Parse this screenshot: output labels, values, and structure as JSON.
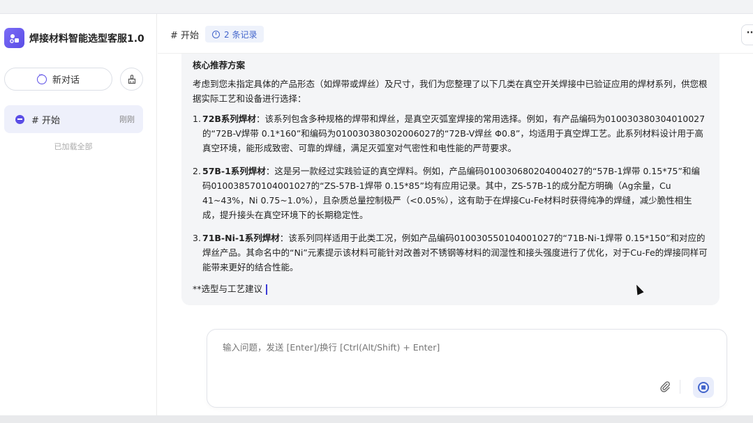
{
  "app": {
    "title": "焊接材料智能选型客服1.0"
  },
  "sidebar": {
    "new_chat_label": "新对话",
    "conversations": [
      {
        "label": "# 开始",
        "time": "刚刚"
      }
    ],
    "loaded_all": "已加载全部"
  },
  "header": {
    "title": "# 开始",
    "records": "2 条记录",
    "more": "···"
  },
  "message": {
    "title": "核心推荐方案",
    "intro": "考虑到您未指定具体的产品形态（如焊带或焊丝）及尺寸，我们为您整理了以下几类在真空开关焊接中已验证应用的焊材系列，供您根据实际工艺和设备进行选择：",
    "items": [
      {
        "num": "1.",
        "name": "72B系列焊材",
        "text": "：该系列包含多种规格的焊带和焊丝，是真空灭弧室焊接的常用选择。例如，有产品编码为010030380304010027的“72B-V焊带 0.1*160”和编码为010030380302006027的“72B-V焊丝 Φ0.8”，均适用于真空焊工艺。此系列材料设计用于高真空环境，能形成致密、可靠的焊缝，满足灭弧室对气密性和电性能的严苛要求。"
      },
      {
        "num": "2.",
        "name": "57B-1系列焊材",
        "text": "：这是另一款经过实践验证的真空焊料。例如，产品编码010030680204004027的“57B-1焊带 0.15*75”和编码010038570104001027的“ZS-57B-1焊带 0.15*85”均有应用记录。其中，ZS-57B-1的成分配方明确（Ag余量，Cu 41~43%，Ni 0.75~1.0%），且杂质总量控制极严（<0.05%），这有助于在焊接Cu-Fe材料时获得纯净的焊缝，减少脆性相生成，提升接头在真空环境下的长期稳定性。"
      },
      {
        "num": "3.",
        "name": "71B-Ni-1系列焊材",
        "text": "：该系列同样适用于此类工况，例如产品编码010030550104001027的“71B-Ni-1焊带 0.15*150”和对应的焊丝产品。其命名中的“Ni”元素提示该材料可能针对改善对不锈钢等材料的润湿性和接头强度进行了优化，对于Cu-Fe的焊接同样可能带来更好的结合性能。"
      }
    ],
    "tail": "**选型与工艺建议"
  },
  "input": {
    "placeholder": "输入问题，发送 [Enter]/换行 [Ctrl(Alt/Shift) + Enter]"
  },
  "colors": {
    "accent": "#5a4de6",
    "link_blue": "#4466cc",
    "bubble_bg": "#f4f5f7",
    "selected_bg": "#eef0fb"
  },
  "icons": {
    "brand": "robot-logo-icon",
    "new_chat": "chat-bubble-icon",
    "clean": "broom-icon",
    "records": "clock-icon",
    "attach": "paperclip-icon",
    "send": "stop-icon"
  }
}
